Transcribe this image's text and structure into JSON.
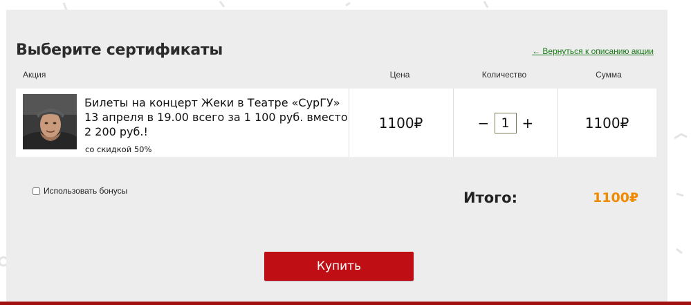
{
  "title": "Выберите сертификаты",
  "back_link": "← Вернуться к описанию акции",
  "columns": {
    "action": "Акция",
    "price": "Цена",
    "quantity": "Количество",
    "sum": "Сумма"
  },
  "item": {
    "title": "Билеты на концерт Жеки в Театре «СурГУ» 13 апреля в 19.00 всего за 1 100 руб. вместо 2 200 руб.!",
    "discount": "со скидкой 50%",
    "price": "1100₽",
    "quantity": "1",
    "minus": "−",
    "plus": "+",
    "sum": "1100₽"
  },
  "bonus_label": "Использовать бонусы",
  "total": {
    "label": "Итого:",
    "value": "1100₽"
  },
  "buy_button": "Купить",
  "colors": {
    "accent": "#bf0f14",
    "total": "#f08a00",
    "link": "#1a7a1a"
  }
}
